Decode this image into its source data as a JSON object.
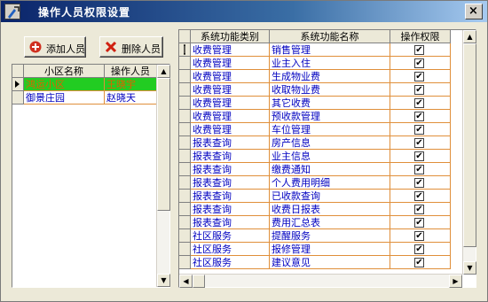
{
  "window": {
    "title": "操作人员权限设置",
    "close_label": "×"
  },
  "buttons": {
    "add_label": "添加人员",
    "delete_label": "删除人员"
  },
  "left_grid": {
    "headers": [
      "小区名称",
      "操作人员"
    ],
    "rows": [
      {
        "community": "鸿运小区",
        "operator": "王晓宇",
        "selected": true
      },
      {
        "community": "御景庄园",
        "operator": "赵晓天",
        "selected": false
      }
    ]
  },
  "right_grid": {
    "headers": [
      "系统功能类别",
      "系统功能名称",
      "操作权限"
    ],
    "rows": [
      {
        "category": "收费管理",
        "name": "销售管理",
        "checked": true
      },
      {
        "category": "收费管理",
        "name": "业主入住",
        "checked": true
      },
      {
        "category": "收费管理",
        "name": "生成物业费",
        "checked": true
      },
      {
        "category": "收费管理",
        "name": "收取物业费",
        "checked": true
      },
      {
        "category": "收费管理",
        "name": "其它收费",
        "checked": true
      },
      {
        "category": "收费管理",
        "name": "预收款管理",
        "checked": true
      },
      {
        "category": "收费管理",
        "name": "车位管理",
        "checked": true
      },
      {
        "category": "报表查询",
        "name": "房产信息",
        "checked": true
      },
      {
        "category": "报表查询",
        "name": "业主信息",
        "checked": true
      },
      {
        "category": "报表查询",
        "name": "缴费通知",
        "checked": true
      },
      {
        "category": "报表查询",
        "name": "个人费用明细",
        "checked": true
      },
      {
        "category": "报表查询",
        "name": "已收款查询",
        "checked": true
      },
      {
        "category": "报表查询",
        "name": "收费日报表",
        "checked": true
      },
      {
        "category": "报表查询",
        "name": "费用汇总表",
        "checked": true
      },
      {
        "category": "社区服务",
        "name": "提醒服务",
        "checked": true
      },
      {
        "category": "社区服务",
        "name": "报修管理",
        "checked": true
      },
      {
        "category": "社区服务",
        "name": "建议意见",
        "checked": true
      }
    ]
  },
  "colors": {
    "selected_row": "#22cc22",
    "cell_text": "#0000c0",
    "grid_line": "#e08f3a"
  }
}
